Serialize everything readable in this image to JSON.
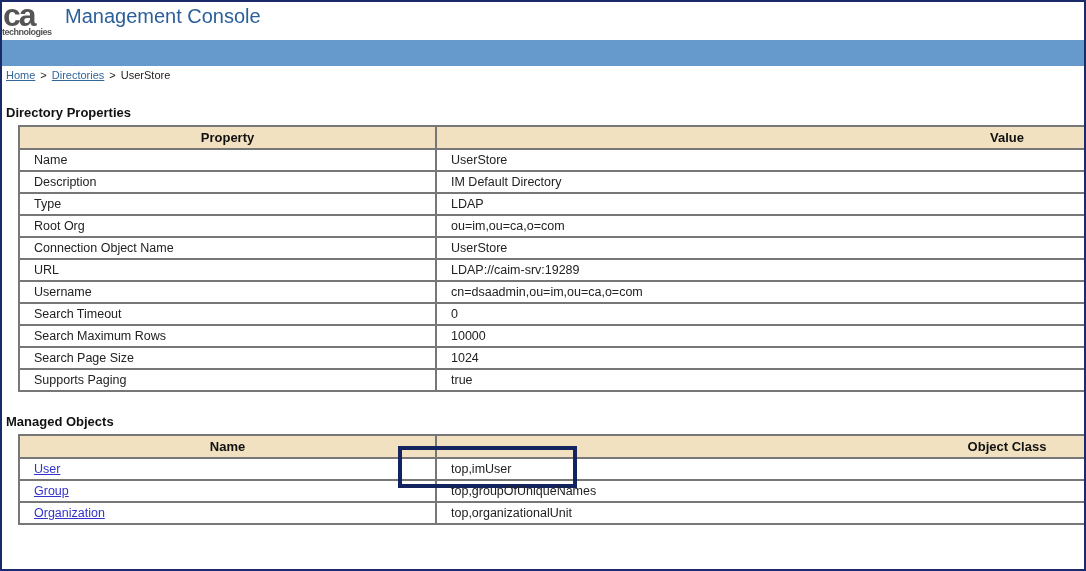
{
  "header": {
    "logo_mark": "ca",
    "logo_subtitle": "technologies",
    "title": "Management Console"
  },
  "breadcrumb": [
    {
      "label": "Home",
      "kind": "link"
    },
    {
      "label": ">",
      "kind": "separator"
    },
    {
      "label": "Directories",
      "kind": "link"
    },
    {
      "label": ">",
      "kind": "separator"
    },
    {
      "label": "UserStore",
      "kind": "current"
    }
  ],
  "properties": {
    "title": "Directory Properties",
    "columns": [
      "Property",
      "Value"
    ],
    "rows": [
      [
        "Name",
        "UserStore"
      ],
      [
        "Description",
        "IM Default Directory"
      ],
      [
        "Type",
        "LDAP"
      ],
      [
        "Root Org",
        "ou=im,ou=ca,o=com"
      ],
      [
        "Connection Object Name",
        "UserStore"
      ],
      [
        "URL",
        "LDAP://caim-srv:19289"
      ],
      [
        "Username",
        "cn=dsaadmin,ou=im,ou=ca,o=com"
      ],
      [
        "Search Timeout",
        "0"
      ],
      [
        "Search Maximum Rows",
        "10000"
      ],
      [
        "Search Page Size",
        "1024"
      ],
      [
        "Supports Paging",
        "true"
      ]
    ]
  },
  "managed_objects": {
    "title": "Managed Objects",
    "columns": [
      "Name",
      "Object Class"
    ],
    "rows": [
      {
        "name": "User",
        "object_class": "top,imUser",
        "highlighted": true
      },
      {
        "name": "Group",
        "object_class": "top,groupOfUniqueNames",
        "highlighted": false
      },
      {
        "name": "Organization",
        "object_class": "top,organizationalUnit",
        "highlighted": false
      }
    ]
  }
}
